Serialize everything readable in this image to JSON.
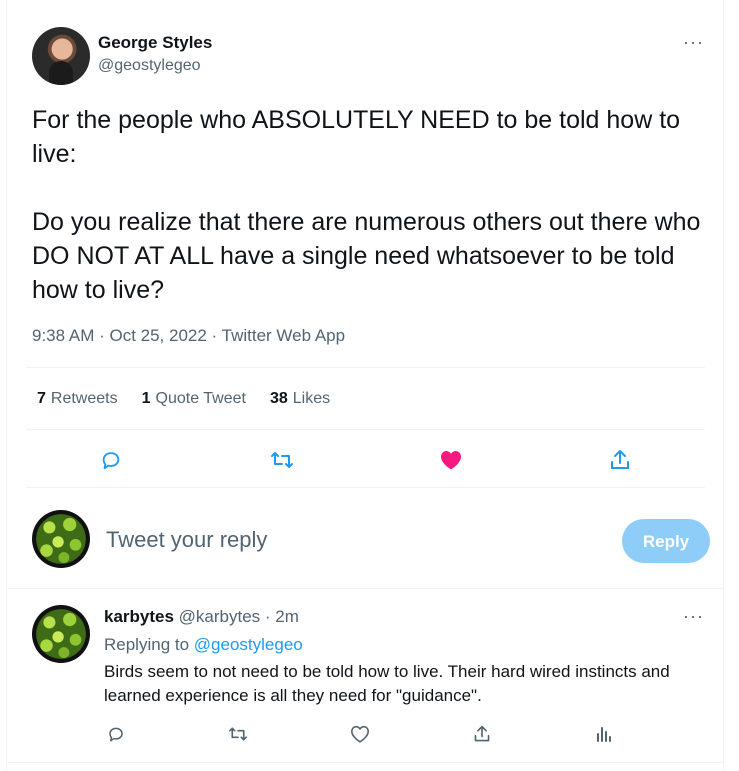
{
  "tweet": {
    "author_name": "George Styles",
    "author_handle": "@geostylegeo",
    "more": "···",
    "text": "For the people who ABSOLUTELY NEED to be told how to live:\n\nDo you realize that there are numerous others out there who DO NOT AT ALL have a single need whatsoever to be told how to live?",
    "meta": "9:38 AM · Oct 25, 2022 · Twitter Web App",
    "stats": [
      {
        "count": "7",
        "label": "Retweets"
      },
      {
        "count": "1",
        "label": "Quote Tweet"
      },
      {
        "count": "38",
        "label": "Likes"
      }
    ],
    "actions": {
      "reply_icon": "comment-icon",
      "retweet_icon": "retweet-icon",
      "like_icon": "heart-filled-icon",
      "share_icon": "share-icon",
      "like_color": "#f91880",
      "icon_color": "#1d9bf0"
    }
  },
  "composer": {
    "placeholder": "Tweet your reply",
    "reply_button": "Reply"
  },
  "reply": {
    "author_name": "karbytes",
    "author_handle": "@karbytes",
    "time": "· 2m",
    "replying_prefix": "Replying to",
    "replying_to": "@geostylegeo",
    "text": "Birds seem to not need to be told how to live. Their hard wired instincts and learned experience is all they need for \"guidance\".",
    "more": "···",
    "actions": [
      "comment-icon",
      "retweet-icon",
      "heart-icon",
      "share-icon",
      "analytics-icon"
    ]
  }
}
